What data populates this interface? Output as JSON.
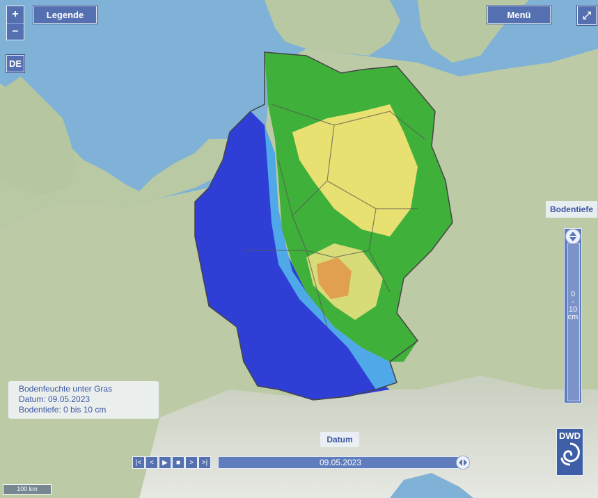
{
  "header": {
    "legend_label": "Legende",
    "menu_label": "Menü",
    "country_label": "DE",
    "zoom_in": "+",
    "zoom_out": "−"
  },
  "info_box": {
    "title": "Bodenfeuchte unter Gras",
    "date_line": "Datum: 09.05.2023",
    "depth_line": "Bodentiefe: 0 bis 10 cm"
  },
  "depth_slider": {
    "label": "Bodentiefe",
    "value_top": "0",
    "value_sep": "-",
    "value_bottom": "10",
    "unit": "cm"
  },
  "time_slider": {
    "label": "Datum",
    "value": "09.05.2023"
  },
  "player": [
    "first-icon",
    "prev-icon",
    "play-icon",
    "stop-icon",
    "next-icon",
    "last-icon"
  ],
  "logo": {
    "text": "DWD"
  },
  "scale_bar": {
    "label": "100 km"
  },
  "colors": {
    "sea": "#7fb2d6",
    "land": "#b9c9a4",
    "wet": "#2f3fd6",
    "moist": "#4fa8e8",
    "normal": "#3fb03a",
    "dry": "#e8e070",
    "very_dry": "#e0a050",
    "button": "#5470b0"
  }
}
